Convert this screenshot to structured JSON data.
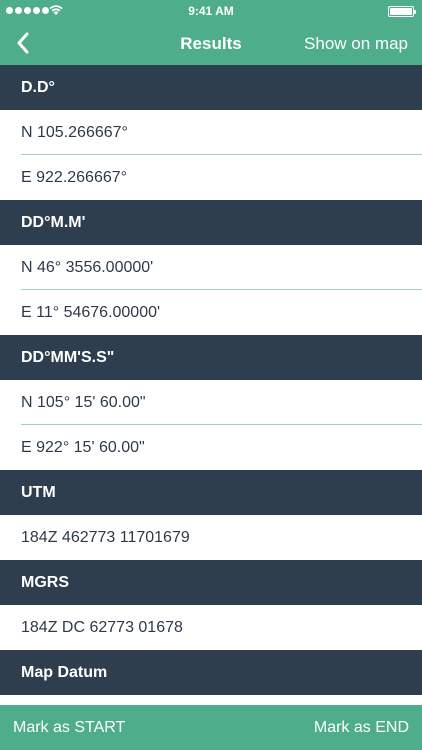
{
  "status_bar": {
    "time": "9:41 AM",
    "icons": [
      "signal-dots",
      "wifi-icon",
      "battery-icon"
    ]
  },
  "nav": {
    "back_icon": "chevron-left-icon",
    "title": "Results",
    "right_action": "Show on map"
  },
  "sections": [
    {
      "header": "D.D°",
      "rows": [
        "N 105.266667°",
        "E 922.266667°"
      ]
    },
    {
      "header": "DD°M.M'",
      "rows": [
        "N 46° 3556.00000'",
        "E 11° 54676.00000'"
      ]
    },
    {
      "header": "DD°MM'S.S\"",
      "rows": [
        "N 105° 15' 60.00\"",
        "E 922° 15' 60.00\""
      ]
    },
    {
      "header": "UTM",
      "rows": [
        "184Z 462773 11701679"
      ]
    },
    {
      "header": "MGRS",
      "rows": [
        "184Z DC 62773 01678"
      ]
    },
    {
      "header": "Map Datum",
      "rows": []
    }
  ],
  "toolbar": {
    "mark_start": "Mark as START",
    "mark_end": "Mark as END"
  },
  "colors": {
    "accent_green": "#4fae8a",
    "section_dark": "#2e3e4e",
    "separator": "#9fd3bf"
  }
}
